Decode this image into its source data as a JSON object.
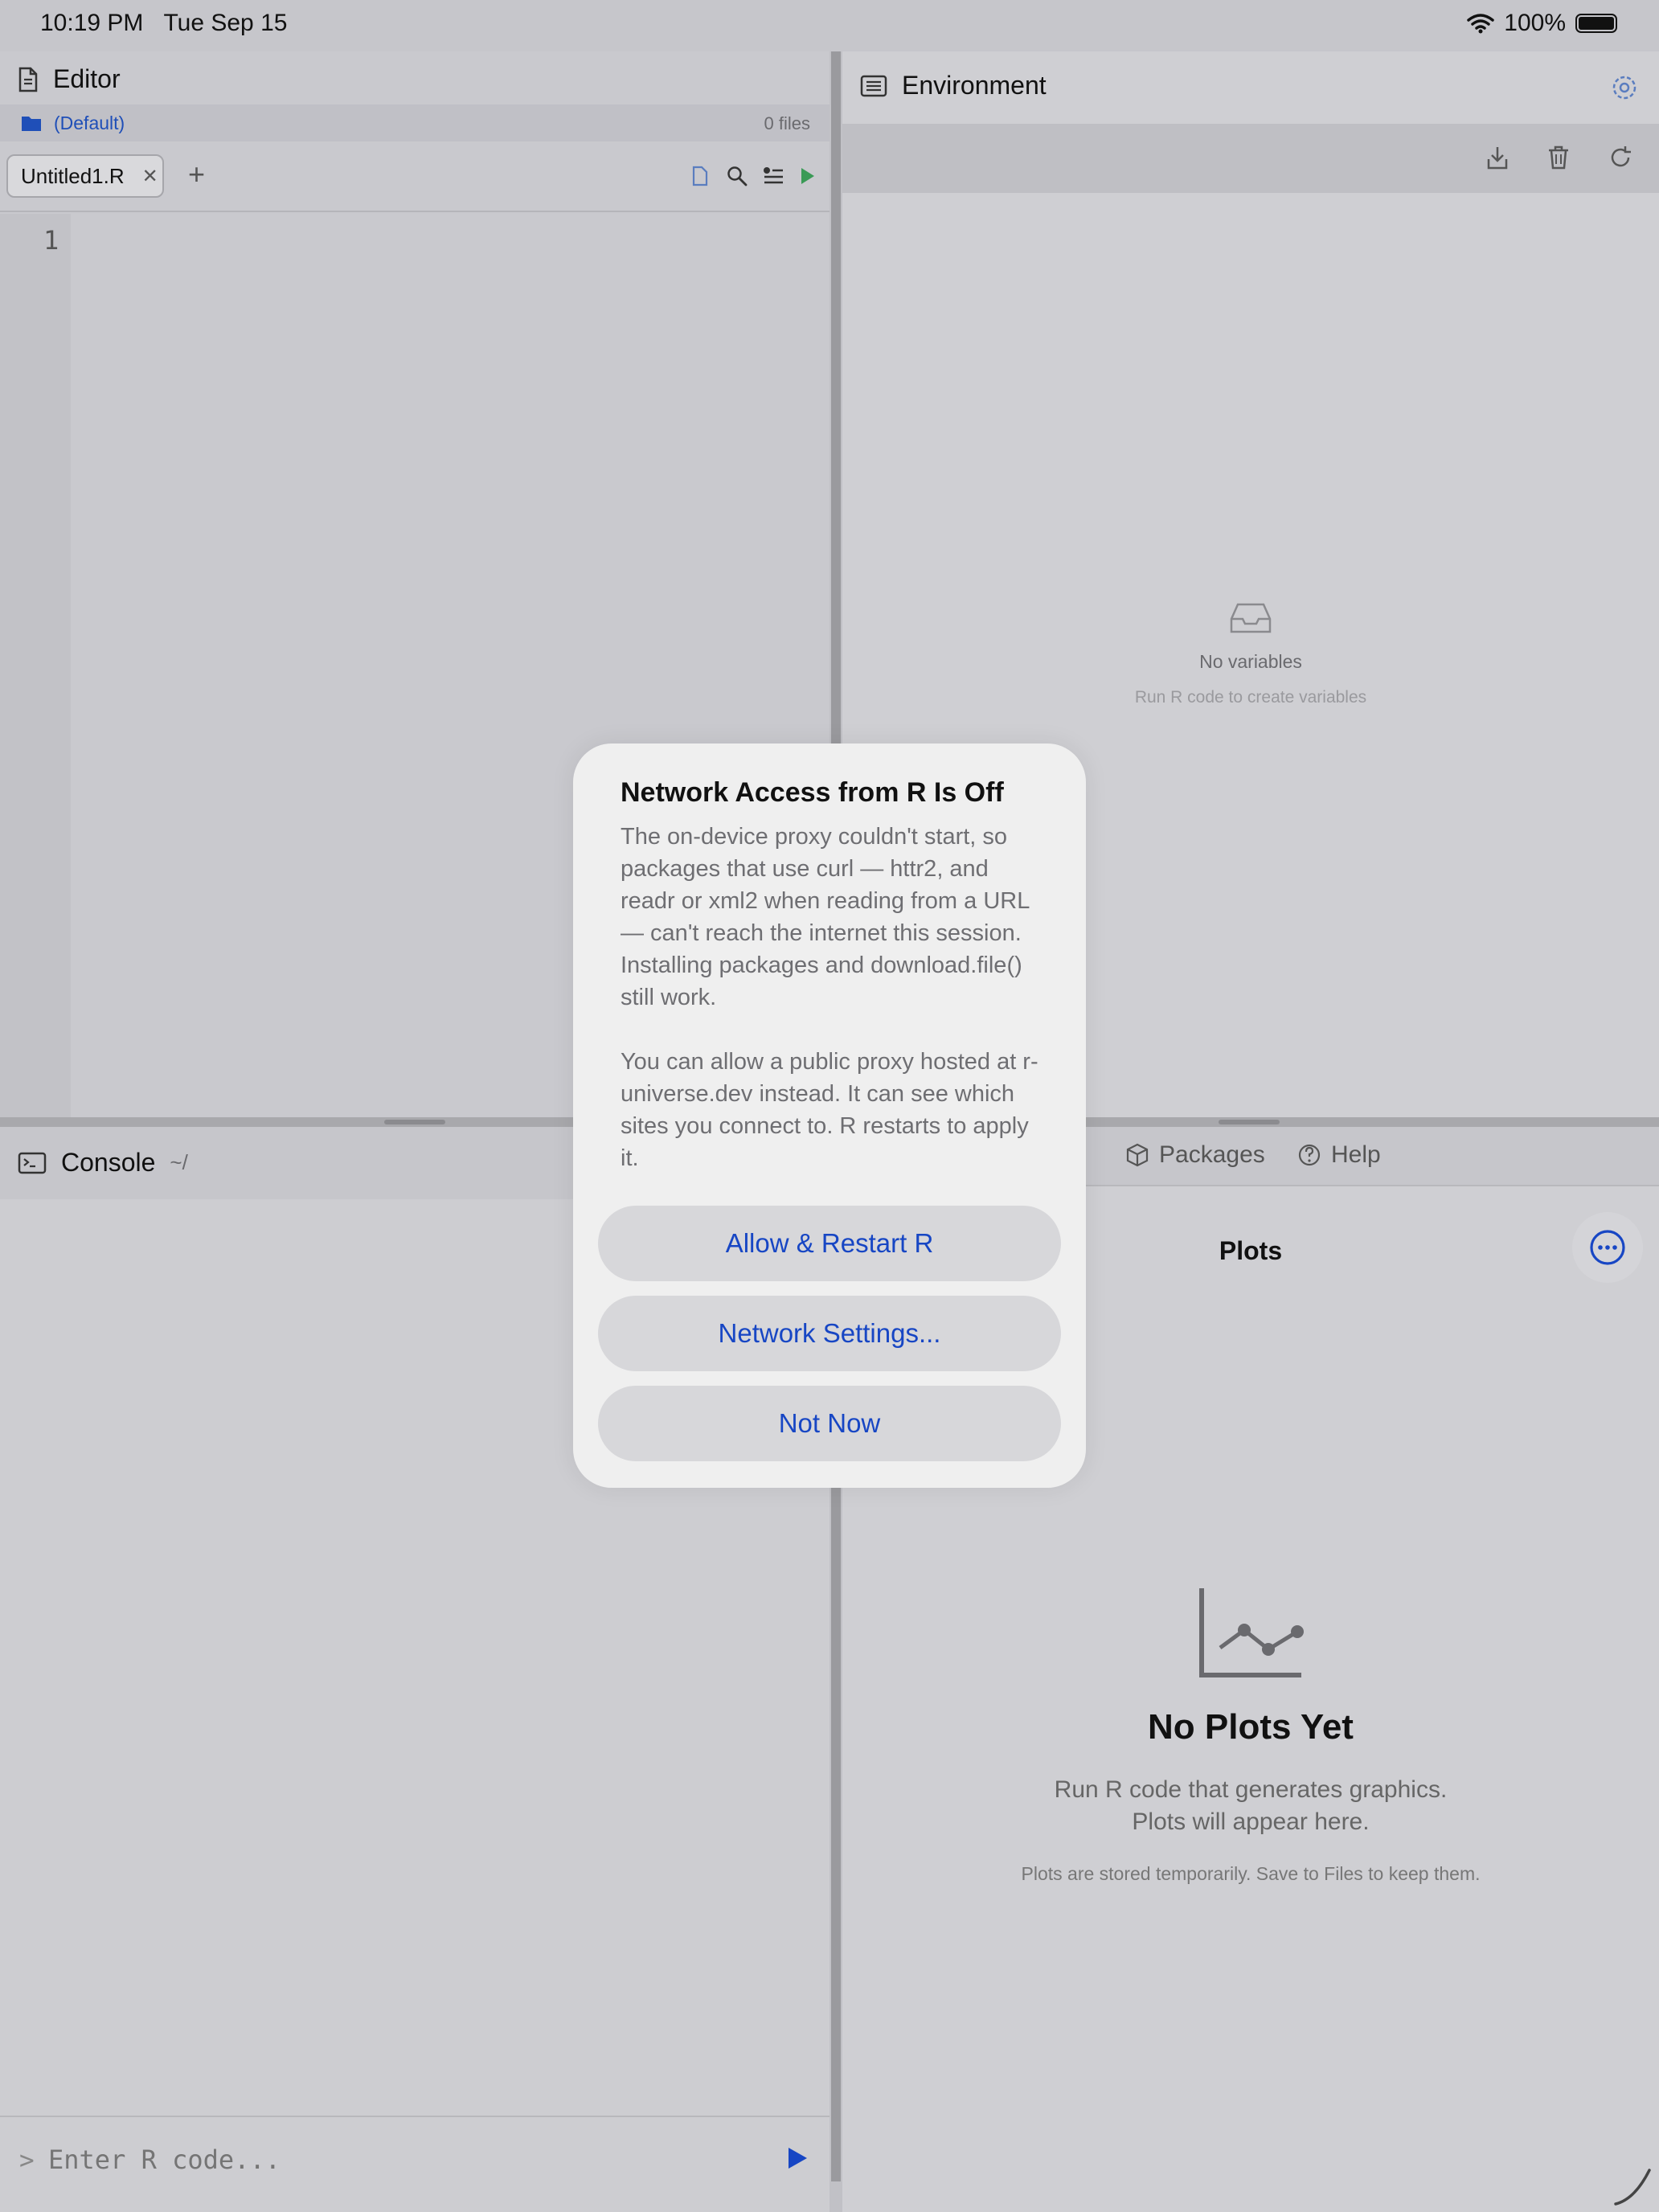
{
  "status_bar": {
    "time": "10:19 PM",
    "date": "Tue Sep 15",
    "battery": "100%"
  },
  "editor": {
    "title": "Editor",
    "project": "(Default)",
    "file_count": "0 files",
    "tab_label": "Untitled1.R",
    "line_numbers": [
      "1"
    ]
  },
  "environment": {
    "title": "Environment",
    "empty_title": "No variables",
    "empty_subtitle": "Run R code to create variables"
  },
  "console": {
    "title": "Console",
    "path": "~/",
    "prompt": ">",
    "placeholder": "Enter R code..."
  },
  "plots": {
    "tabs": [
      "Packages",
      "Help"
    ],
    "title": "Plots",
    "empty_title": "No Plots Yet",
    "empty_line1": "Run R code that generates graphics.",
    "empty_line2": "Plots will appear here.",
    "note": "Plots are stored temporarily. Save to Files to keep them."
  },
  "dialog": {
    "title": "Network Access from R Is Off",
    "message": "The on-device proxy couldn't start, so packages that use curl — httr2, and readr or xml2 when reading from a URL — can't reach the internet this session. Installing packages and download.file() still work.\n\nYou can allow a public proxy hosted at r-universe.dev instead. It can see which sites you connect to. R restarts to apply it.",
    "buttons": [
      "Allow & Restart R",
      "Network Settings...",
      "Not Now"
    ]
  },
  "colors": {
    "accent": "#1746c4",
    "folder_blue": "#1f4fb8",
    "run_green": "#3a9a56"
  }
}
